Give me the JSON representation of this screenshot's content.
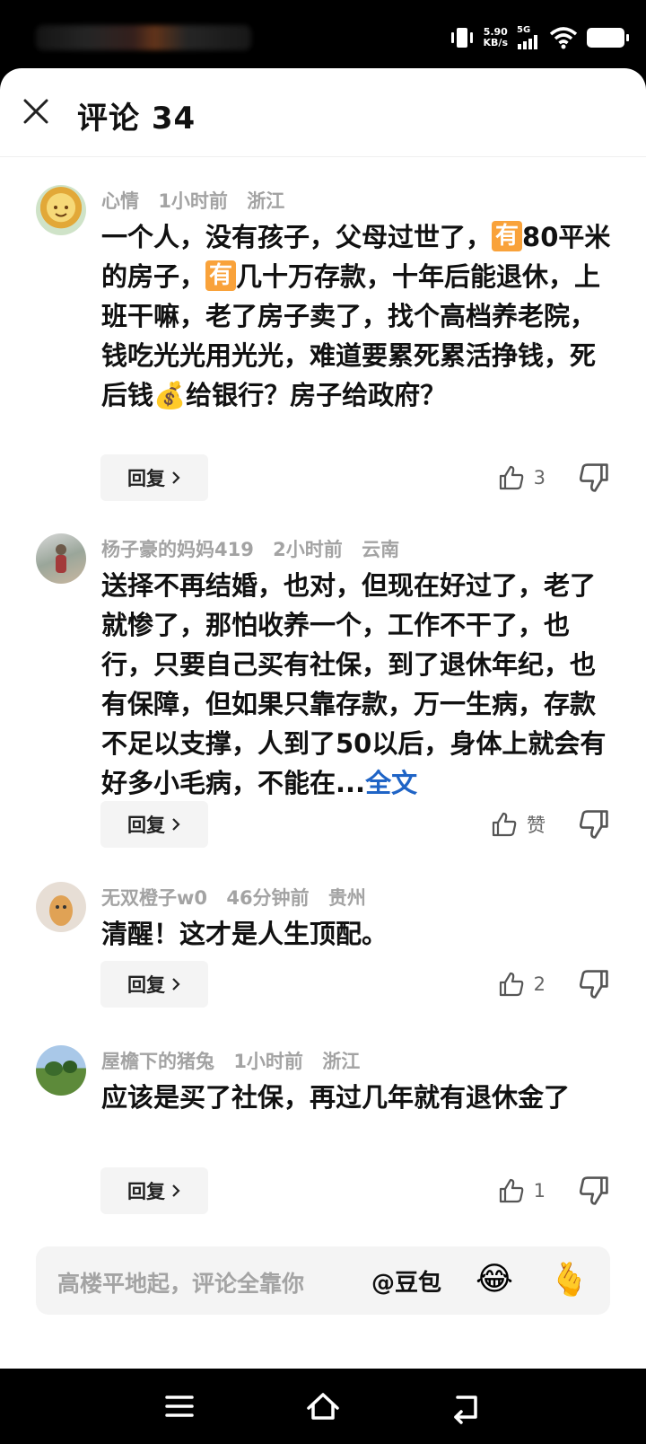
{
  "status": {
    "net_speed": "5.90",
    "net_unit": "KB/s",
    "net_type": "5G"
  },
  "header": {
    "title": "评论 34"
  },
  "comments": [
    {
      "user": "心情",
      "time": "1小时前",
      "location": "浙江",
      "text_parts": [
        "一个人，没有孩子，父母过世了，",
        "有",
        "80平米的房子，",
        "有",
        "几十万存款，十年后能退休，上班干嘛，老了房子卖了，找个高档养老院，钱吃光光用光光，难道要累死累活挣钱，死后钱",
        "💰",
        "给银行？房子给政府？"
      ],
      "reply_label": "回复",
      "likes": "3"
    },
    {
      "user": "杨子豪的妈妈419",
      "time": "2小时前",
      "location": "云南",
      "text": "送择不再结婚，也对，但现在好过了，老了就惨了，那怕收养一个，工作不干了，也行，只要自己买有社保，到了退休年纪，也有保障，但如果只靠存款，万一生病，存款不足以支撑，人到了50以后，身体上就会有好多小毛病，不能在...",
      "more_label": "全文",
      "reply_label": "回复",
      "likes": "赞"
    },
    {
      "user": "无双橙子w0",
      "time": "46分钟前",
      "location": "贵州",
      "text": "清醒！这才是人生顶配。",
      "reply_label": "回复",
      "likes": "2"
    },
    {
      "user": "屋檐下的猪兔",
      "time": "1小时前",
      "location": "浙江",
      "text": "应该是买了社保，再过几年就有退休金了",
      "reply_label": "回复",
      "likes": "1"
    }
  ],
  "input": {
    "placeholder": "高楼平地起，评论全靠你",
    "mention": "@豆包",
    "emoji1": "😂",
    "emoji2": "🫰"
  },
  "icons": [
    "close-icon",
    "like-icon",
    "dislike-icon",
    "chevron-right-icon",
    "menu-icon",
    "home-icon",
    "back-icon"
  ]
}
